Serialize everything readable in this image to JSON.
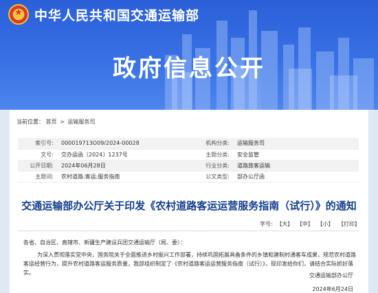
{
  "header": {
    "ministry": "中华人民共和国交通运输部",
    "section": "政府信息公开"
  },
  "breadcrumb": {
    "label": "当前位置：",
    "items": [
      "首页",
      "运输服务司"
    ],
    "separator": ">"
  },
  "meta": [
    {
      "k1": "索引号:",
      "v1": "000019713O09/2024-00028",
      "k2": "机构分类:",
      "v2": "运输服务司"
    },
    {
      "k1": "文号:",
      "v1": "交办运函〔2024〕1237号",
      "k2": "主题分类:",
      "v2": "安全监管"
    },
    {
      "k1": "公开日期:",
      "v1": "2024年06月28日",
      "k2": "行业分类:",
      "v2": "道路旅客运输"
    },
    {
      "k1": "主题词:",
      "v1": "农村道路;客运;服务指南",
      "k2": "公文类型:",
      "v2": "部办公厅函"
    }
  ],
  "document": {
    "title": "交通运输部办公厅关于印发《农村道路客运运营服务指南（试行）》的通知",
    "font_size_label": "字号:",
    "font_options": [
      "【大】",
      "【中】",
      "【小】"
    ],
    "print_label": "【打印】",
    "salutation": "各省、自治区、直辖市、新疆生产建设兵团交通运输厅（局、委）：",
    "body": "为深入贯彻落实党中央、国务院关于全面推进乡村振兴工作部署，持续巩固拓展具备条件的乡镇和建制村通客车成果，规范农村道路客运经营行为，提升农村道路客运服务质量，我部组织制定了《农村道路客运运营服务指南（试行）》，现印发给你们，请结合实际抓好落实。",
    "signature": "交通运输部办公厅",
    "date": "2024年6月24日"
  },
  "colors": {
    "banner": "#3a73e6",
    "title": "#123d8f"
  }
}
